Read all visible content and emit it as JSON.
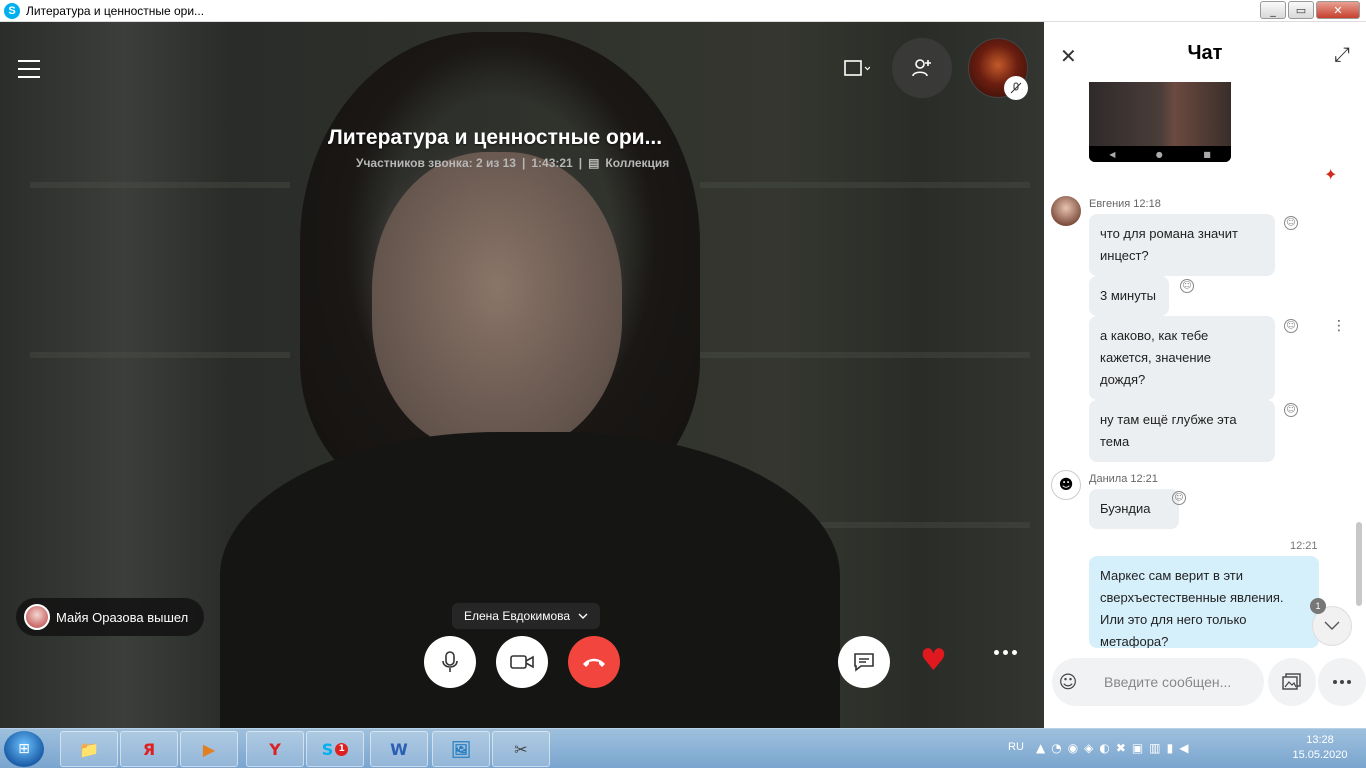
{
  "window": {
    "title": "Литература и ценностные ори...",
    "controls": [
      "_",
      "▭",
      "✕"
    ]
  },
  "call": {
    "title": "Литература и ценностные ори...",
    "participants": "Участников звонка: 2 из 13",
    "separator": "|",
    "duration": "1:43:21",
    "collection": "Коллекция",
    "speaker": "Елена Евдокимова",
    "toast": "Майя Оразова вышел"
  },
  "chat": {
    "title": "Чат",
    "shared_image_nav": [
      "◀",
      "●",
      "■"
    ],
    "messages": [
      {
        "sender": "Евгения 12:18",
        "text_lines": [
          "что для романа значит",
          "инцест?"
        ]
      },
      {
        "text_lines": [
          "3 минуты"
        ]
      },
      {
        "text_lines": [
          "а каково, как тебе",
          "кажется, значение",
          "дождя?"
        ]
      },
      {
        "text_lines": [
          "ну там ещё глубже эта",
          "тема"
        ]
      },
      {
        "sender": "Данила 12:21",
        "text_lines": [
          "Буэндиа"
        ]
      },
      {
        "time": "12:21",
        "text_lines": [
          "Маркес сам верит в эти",
          "сверхъестественные явления.",
          "Или это для него только",
          "метафора?"
        ]
      }
    ],
    "unread_count": "1",
    "composer_placeholder": "Введите сообщен..."
  },
  "taskbar": {
    "apps": [
      "📁",
      "Я",
      "▶",
      "Y",
      "S",
      "W",
      "🖼",
      "✂"
    ],
    "skype_badge": "1",
    "lang": "RU",
    "time": "13:28",
    "date": "15.05.2020"
  }
}
